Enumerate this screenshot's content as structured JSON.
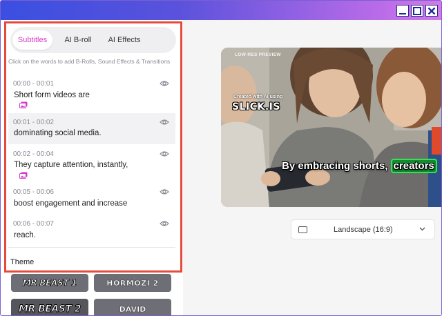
{
  "window": {
    "controls": [
      "minimize",
      "maximize",
      "close"
    ]
  },
  "tabs": [
    {
      "label": "Subtitles",
      "active": true
    },
    {
      "label": "AI B-roll",
      "active": false
    },
    {
      "label": "AI Effects",
      "active": false
    }
  ],
  "hint": "Click on the words to add B-Rolls, Sound Effects & Transitions",
  "segments": [
    {
      "time": "00:00 - 00:01",
      "text": "Short form videos are",
      "has_broll": true,
      "highlighted": false
    },
    {
      "time": "00:01 - 00:02",
      "text": "dominating social media.",
      "has_broll": false,
      "highlighted": true
    },
    {
      "time": "00:02 - 00:04",
      "text": "They capture attention, instantly,",
      "has_broll": true,
      "highlighted": false
    },
    {
      "time": "00:05 - 00:06",
      "text": "boost engagement and increase",
      "has_broll": false,
      "highlighted": false
    },
    {
      "time": "00:06 - 00:07",
      "text": "reach.",
      "has_broll": false,
      "highlighted": false
    }
  ],
  "theme": {
    "label": "Theme",
    "cards": [
      "MR BEAST 1",
      "HORMOZI 2",
      "MR BEAST 2",
      "DAVID"
    ]
  },
  "preview": {
    "label": "LOW-RES PREVIEW",
    "watermark_top": "Created with AI using",
    "watermark_brand": "SLICK.IS",
    "caption_before": "By embracing shorts, ",
    "caption_highlight": "creators"
  },
  "aspect": {
    "selected": "Landscape (16:9)"
  },
  "colors": {
    "accent": "#d43cc8",
    "frame": "#e64a3b",
    "caption_highlight": "#0c8f2a",
    "titlebar_start": "#3a4fe0",
    "titlebar_end": "#d27ae8"
  }
}
